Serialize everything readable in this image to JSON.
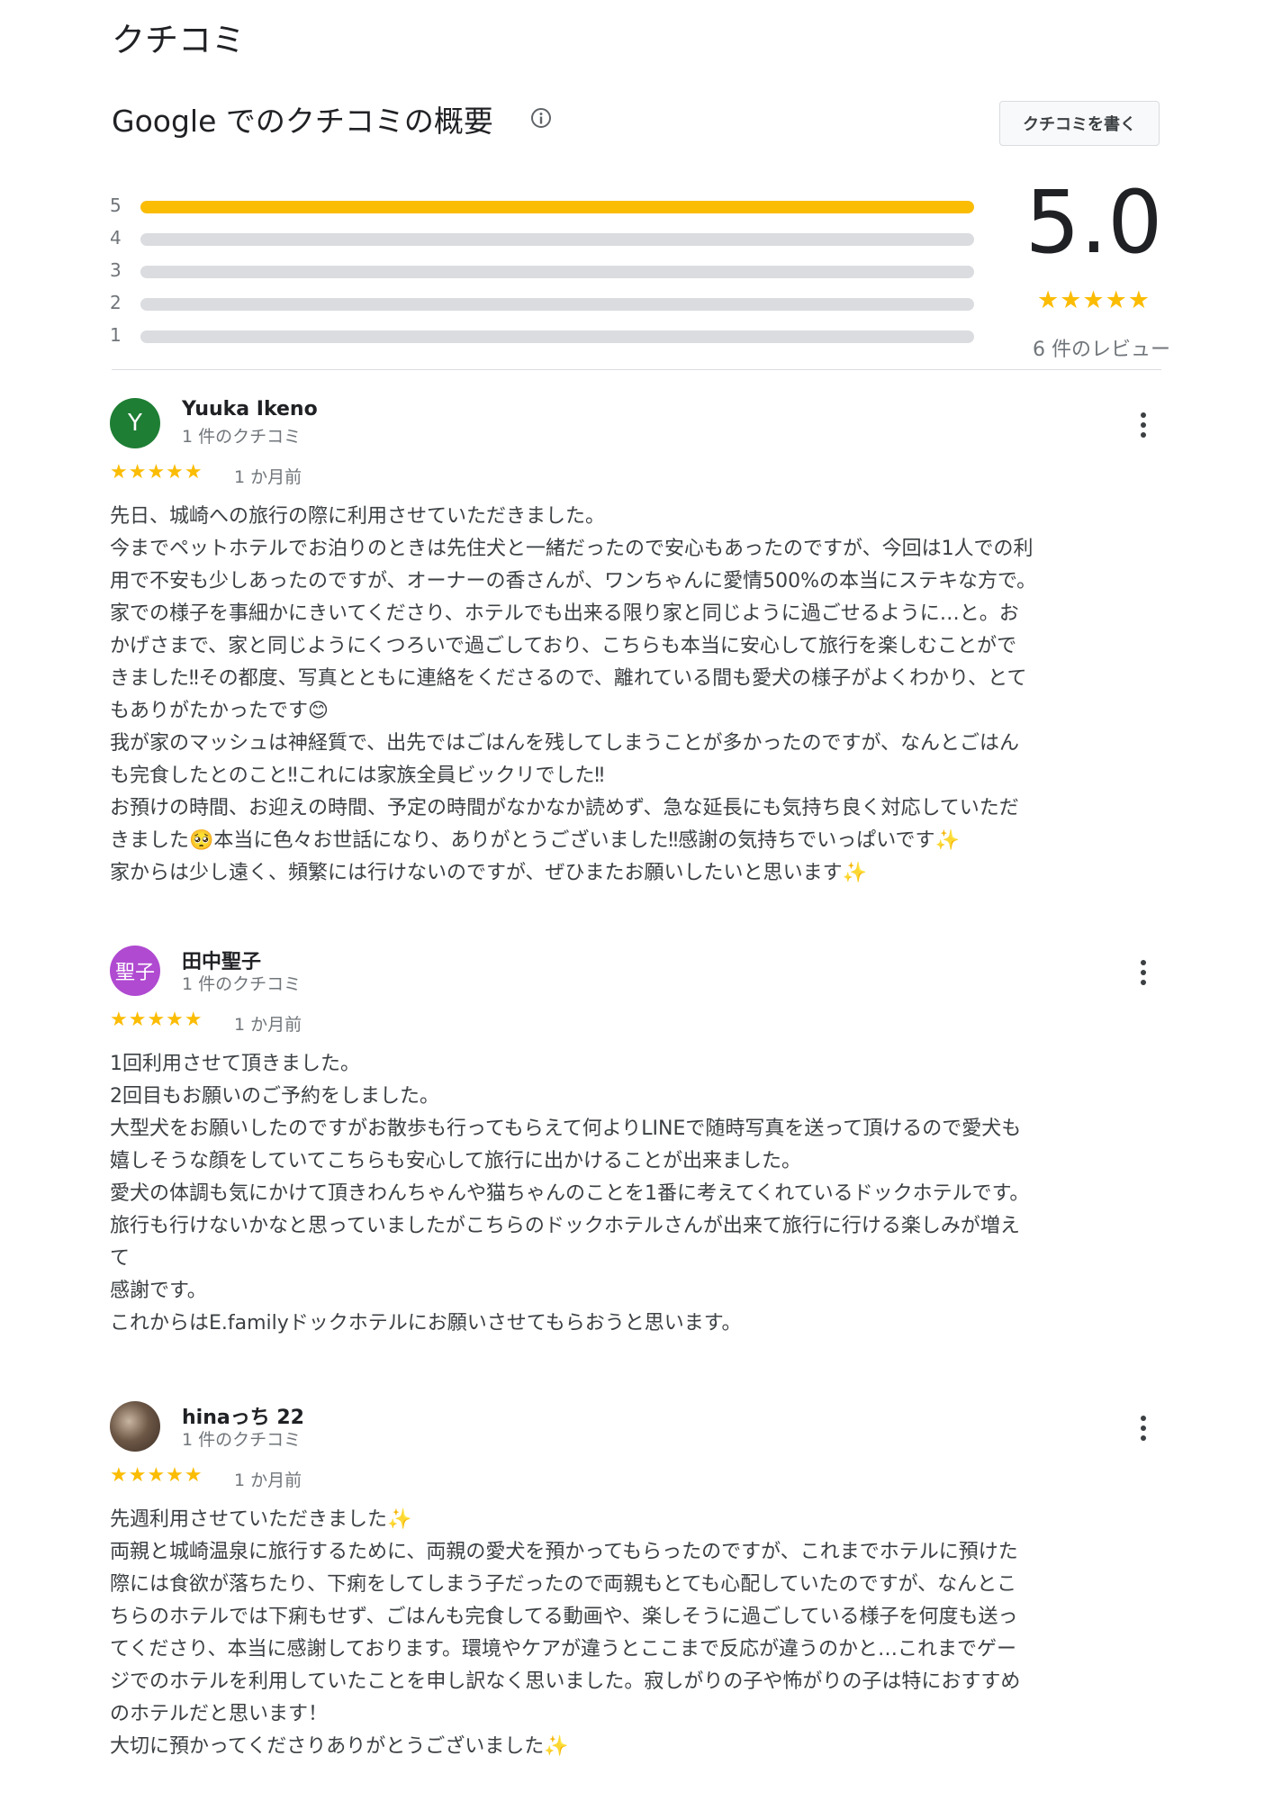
{
  "page": {
    "heading": "クチコミ",
    "summary_title": "Google でのクチコミの概要",
    "write_review_label": "クチコミを書く",
    "info_icon": "info-icon"
  },
  "rating_summary": {
    "average": "5.0",
    "stars": "★★★★★",
    "count_text": "6 件のレビュー",
    "bar_color": "#fbbc04",
    "track_color": "#dadce0",
    "rows": [
      {
        "label": "5",
        "fraction": 1.0
      },
      {
        "label": "4",
        "fraction": 0.0
      },
      {
        "label": "3",
        "fraction": 0.0
      },
      {
        "label": "2",
        "fraction": 0.0
      },
      {
        "label": "1",
        "fraction": 0.0
      }
    ]
  },
  "reviews": [
    {
      "name": "Yuuka Ikeno",
      "avatar_text": "Y",
      "avatar_color": "#1e7e34",
      "meta": "1 件のクチコミ",
      "stars": "★★★★★",
      "date": "1 か月前",
      "text": "先日、城崎への旅行の際に利用させていただきました。\n今までペットホテルでお泊りのときは先住犬と一緒だったので安心もあったのですが、今回は1人での利\n用で不安も少しあったのですが、オーナーの香さんが、ワンちゃんに愛情500%の本当にステキな方で。\n家での様子を事細かにきいてくださり、ホテルでも出来る限り家と同じように過ごせるように…と。お\nかげさまで、家と同じようにくつろいで過ごしており、こちらも本当に安心して旅行を楽しむことがで\nきました‼その都度、写真とともに連絡をくださるので、離れている間も愛犬の様子がよくわかり、とて\nもありがたかったです😊\n我が家のマッシュは神経質で、出先ではごはんを残してしまうことが多かったのですが、なんとごはん\nも完食したとのこと‼これには家族全員ビックリでした‼\nお預けの時間、お迎えの時間、予定の時間がなかなか読めず、急な延長にも気持ち良く対応していただ\nきました🥺本当に色々お世話になり、ありがとうございました‼感謝の気持ちでいっぱいです✨\n家からは少し遠く、頻繁には行けないのですが、ぜひまたお願いしたいと思います✨"
    },
    {
      "name": "田中聖子",
      "avatar_text": "聖子",
      "avatar_color": "#b04ad1",
      "meta": "1 件のクチコミ",
      "stars": "★★★★★",
      "date": "1 か月前",
      "text": "1回利用させて頂きました。\n2回目もお願いのご予約をしました。\n大型犬をお願いしたのですがお散歩も行ってもらえて何よりLINEで随時写真を送って頂けるので愛犬も\n嬉しそうな顔をしていてこちらも安心して旅行に出かけることが出来ました。\n愛犬の体調も気にかけて頂きわんちゃんや猫ちゃんのことを1番に考えてくれているドックホテルです。\n旅行も行けないかなと思っていましたがこちらのドックホテルさんが出来て旅行に行ける楽しみが増え\nて\n感謝です。\nこれからはE.familyドックホテルにお願いさせてもらおうと思います。"
    },
    {
      "name": "hinaっち 22",
      "avatar_text": "",
      "avatar_color": "#6d5746",
      "meta": "1 件のクチコミ",
      "stars": "★★★★★",
      "date": "1 か月前",
      "text": "先週利用させていただきました✨\n両親と城崎温泉に旅行するために、両親の愛犬を預かってもらったのですが、これまでホテルに預けた\n際には食欲が落ちたり、下痢をしてしまう子だったので両親もとても心配していたのですが、なんとこ\nちらのホテルでは下痢もせず、ごはんも完食してる動画や、楽しそうに過ごしている様子を何度も送っ\nてくださり、本当に感謝しております。環境やケアが違うとここまで反応が違うのかと…これまでゲー\nジでのホテルを利用していたことを申し訳なく思いました。寂しがりの子や怖がりの子は特におすすめ\nのホテルだと思います！\n大切に預かってくださりありがとうございました✨"
    }
  ]
}
